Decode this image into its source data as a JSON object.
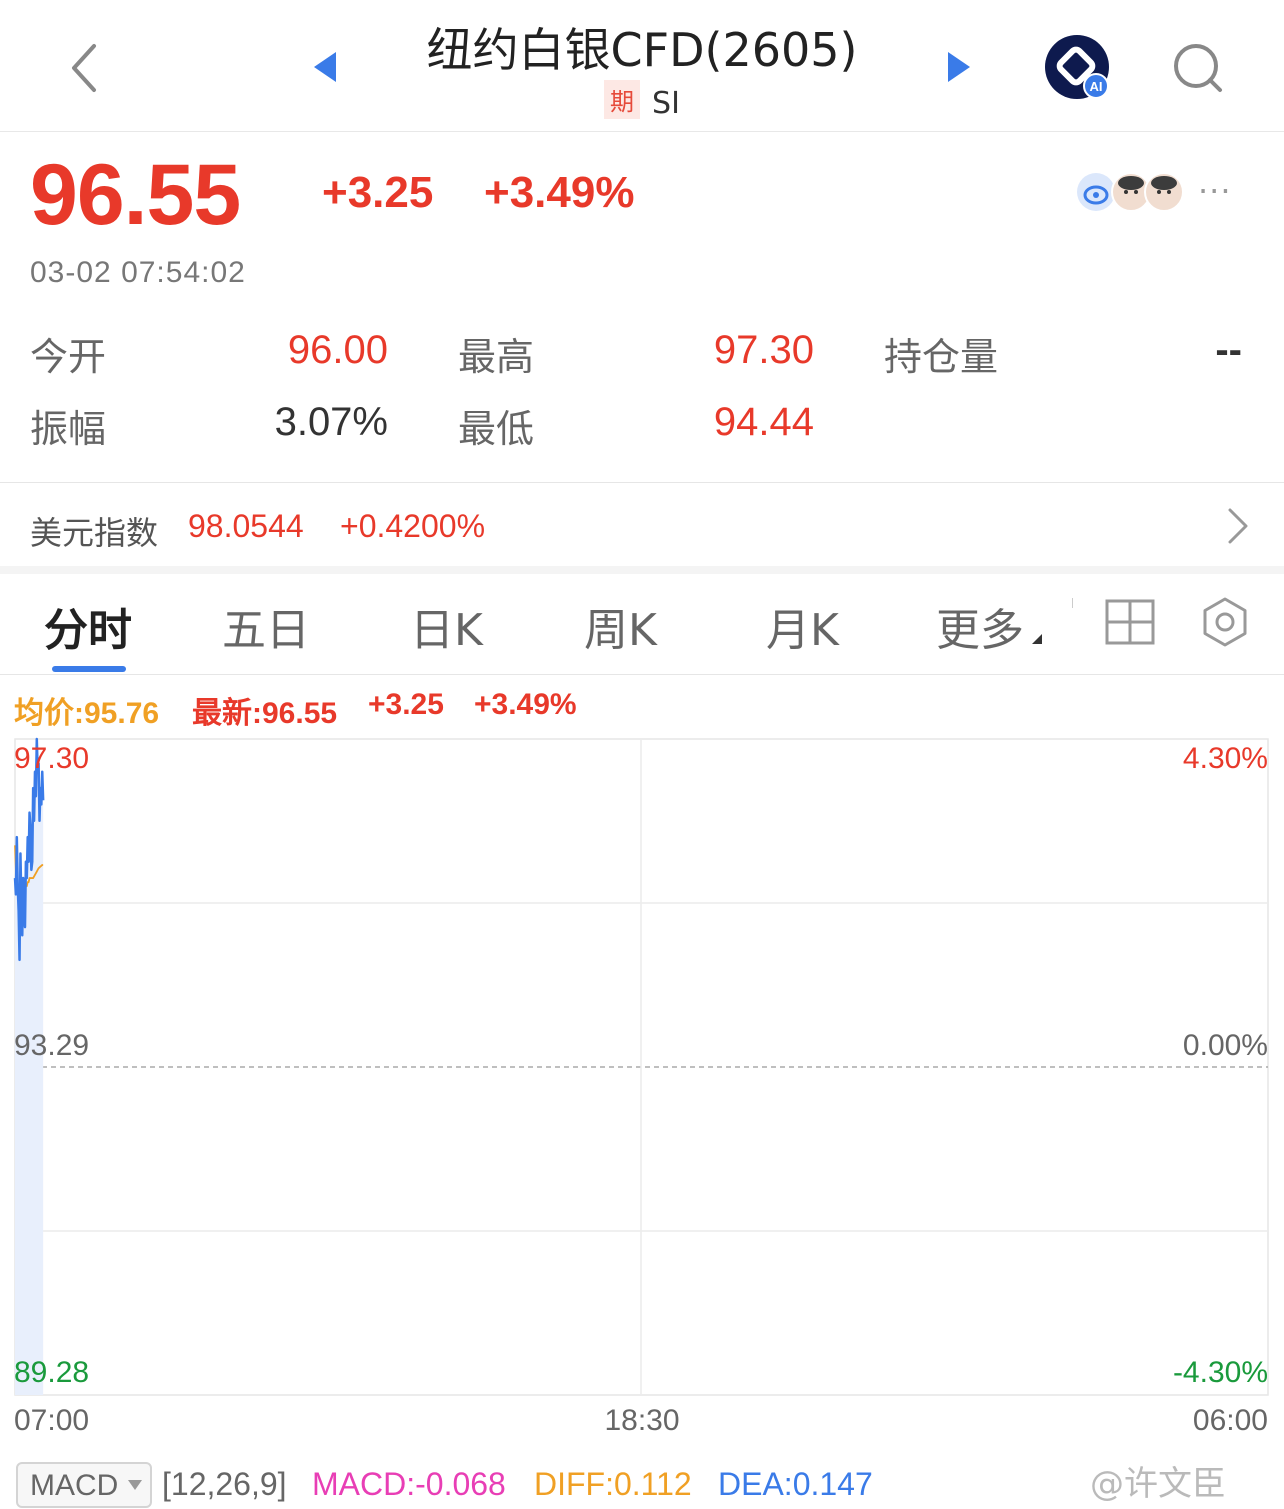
{
  "header": {
    "title": "纽约白银CFD(2605)",
    "badge": "期",
    "symbol": "SI",
    "ai_label": "AI"
  },
  "quote": {
    "price": "96.55",
    "change": "+3.25",
    "change_pct": "+3.49%",
    "timestamp": "03-02 07:54:02",
    "more": "···"
  },
  "stats": {
    "open_label": "今开",
    "open_value": "96.00",
    "high_label": "最高",
    "high_value": "97.30",
    "oi_label": "持仓量",
    "oi_value": "--",
    "amp_label": "振幅",
    "amp_value": "3.07%",
    "low_label": "最低",
    "low_value": "94.44"
  },
  "index_row": {
    "label": "美元指数",
    "value": "98.0544",
    "change": "+0.4200%"
  },
  "tabs": [
    {
      "label": "分时",
      "active": true
    },
    {
      "label": "五日",
      "active": false
    },
    {
      "label": "日K",
      "active": false
    },
    {
      "label": "周K",
      "active": false
    },
    {
      "label": "月K",
      "active": false
    },
    {
      "label": "更多",
      "active": false
    }
  ],
  "chart_info": {
    "avg": "均价:95.76",
    "latest": "最新:96.55",
    "change": "+3.25",
    "change_pct": "+3.49%"
  },
  "chart_data": {
    "type": "line",
    "y_left_ticks": [
      "97.30",
      "93.29",
      "89.28"
    ],
    "y_right_ticks": [
      "4.30%",
      "0.00%",
      "-4.30%"
    ],
    "x_ticks": [
      "07:00",
      "18:30",
      "06:00"
    ],
    "ylim": [
      89.28,
      97.3
    ],
    "reference": 93.29,
    "grid": true,
    "series": [
      {
        "color": "#3a7be8",
        "values": [
          95.6,
          95.4,
          96.1,
          95.5,
          95.2,
          94.6,
          95.9,
          95.3,
          94.9,
          95.6,
          95.3,
          95.0,
          95.8,
          95.6,
          96.1,
          95.8,
          96.4,
          96.2,
          95.7,
          95.8,
          96.7,
          96.3,
          96.9,
          96.6,
          97.3,
          96.9,
          97.0,
          96.3,
          96.7,
          96.5,
          96.9,
          96.55
        ]
      },
      {
        "color": "#f0a024",
        "values": [
          96.0,
          95.7,
          95.6,
          95.5,
          95.5,
          95.5,
          95.5,
          95.5,
          95.5,
          95.5,
          95.5,
          95.5,
          95.5,
          95.5,
          95.55,
          95.55,
          95.6,
          95.6,
          95.6,
          95.6,
          95.6,
          95.62,
          95.64,
          95.66,
          95.68,
          95.7,
          95.72,
          95.73,
          95.74,
          95.75,
          95.76,
          95.76
        ]
      }
    ],
    "fill_color": "#e8effc",
    "points_total": 1380
  },
  "macd": {
    "select_label": "MACD",
    "params": "[12,26,9]",
    "macd": "MACD:-0.068",
    "diff": "DIFF:0.112",
    "dea": "DEA:0.147"
  },
  "watermark": "@许文臣"
}
